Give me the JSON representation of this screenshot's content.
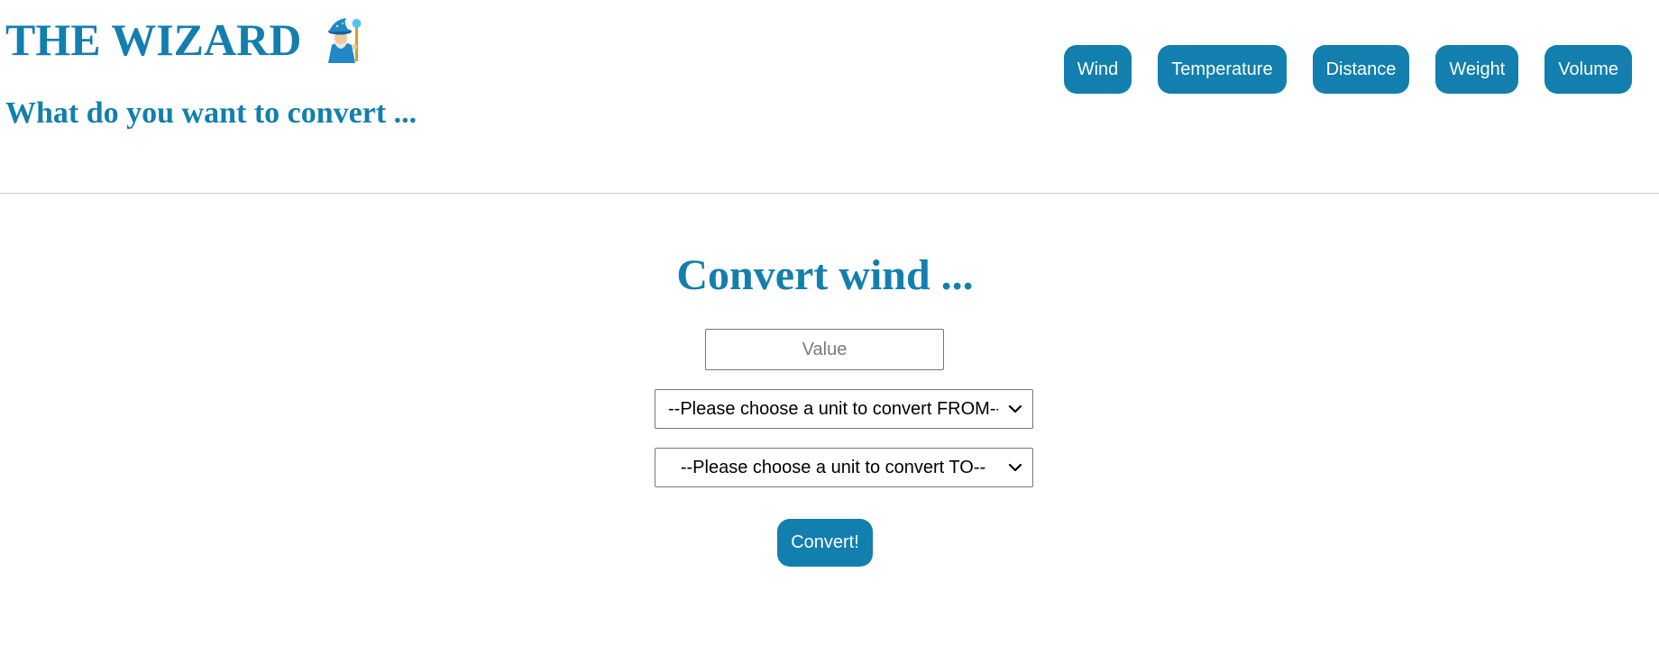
{
  "header": {
    "title": "THE WIZARD",
    "icon": "wizard-emoji-icon",
    "subtitle": "What do you want to convert ..."
  },
  "nav": {
    "items": [
      {
        "label": "Wind"
      },
      {
        "label": "Temperature"
      },
      {
        "label": "Distance"
      },
      {
        "label": "Weight"
      },
      {
        "label": "Volume"
      }
    ]
  },
  "main": {
    "heading": "Convert wind ...",
    "value_input": {
      "value": "",
      "placeholder": "Value"
    },
    "from_select": {
      "selected": "--Please choose a unit to convert FROM--"
    },
    "to_select": {
      "selected": "--Please choose a unit to convert TO--"
    },
    "convert_label": "Convert!"
  },
  "colors": {
    "accent": "#127fae",
    "background": "#ffffff",
    "divider": "#d0d0d0"
  }
}
